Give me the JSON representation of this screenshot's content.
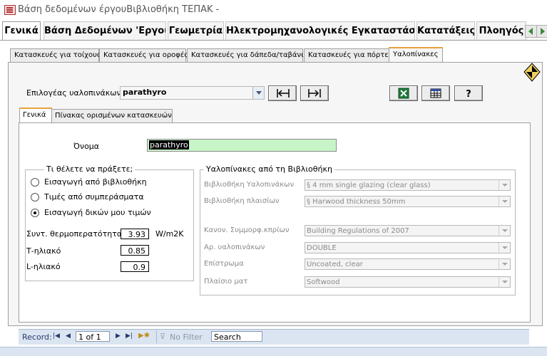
{
  "window": {
    "title": "Βάση δεδομένων έργουΒιβλιοθήκη ΤΕΠΑΚ -"
  },
  "main_tabs": [
    {
      "label": "Γενικά"
    },
    {
      "label": "Βάση Δεδομένων 'Εργου"
    },
    {
      "label": "Γεωμετρία"
    },
    {
      "label": "Ηλεκτρομηχανολογικές Εγκαταστάσεις"
    },
    {
      "label": "Κατατάξεις"
    },
    {
      "label": "Πλοηγός"
    }
  ],
  "sub_tabs": [
    {
      "label": "Κατασκευές για τοίχους"
    },
    {
      "label": "Κατασκευές για οροφές"
    },
    {
      "label": "Κατασκευές για δάπεδα/ταβάνια"
    },
    {
      "label": "Κατασκευές για πόρτες"
    },
    {
      "label": "Υαλοπίνακες"
    }
  ],
  "selector": {
    "label": "Επιλογέας υαλοπινάκων",
    "value": "parathyro"
  },
  "inner_tabs": [
    {
      "label": "Γενικά"
    },
    {
      "label": "Πίνακας ορισμένων κατασκευών"
    }
  ],
  "name_field": {
    "label": "Όνομα",
    "value": "parathyro"
  },
  "action_group": {
    "title": "Τι θέλετε να πράξετε;",
    "options": [
      {
        "label": "Εισαγωγή από βιβλιοθήκη",
        "selected": false
      },
      {
        "label": "Τιμές από συμπεράσματα",
        "selected": false
      },
      {
        "label": "Εισαγωγή δικών μου τιμών",
        "selected": true
      }
    ]
  },
  "values": {
    "u_label": "Συντ. θερμοπερατότητας",
    "u_value": "3.93",
    "u_unit": "W/m2K",
    "t_label": "Τ-ηλιακό",
    "t_value": "0.85",
    "l_label": "L-ηλιακό",
    "l_value": "0.9"
  },
  "library_group": {
    "title": "Υαλοπίνακες από τη Βιβλιοθήκη",
    "fields": [
      {
        "label": "Βιβλιοθήκη Υαλοπινάκων",
        "value": "§ 4 mm single glazing (clear glass)"
      },
      {
        "label": "Βιβλιοθήκη πλαισίων",
        "value": "§ Harwood thickness 50mm"
      },
      {
        "label": "Κανον. Συμμορφ.κπρίων",
        "value": "Building Regulations of 2007"
      },
      {
        "label": "Αρ. υαλοπινάκων",
        "value": "DOUBLE"
      },
      {
        "label": "Επίστρωμα",
        "value": "Uncoated, clear"
      },
      {
        "label": "Πλαίσιο ματ",
        "value": "Softwood"
      }
    ]
  },
  "status_bar": {
    "record_label": "Record:",
    "position": "1 of 1",
    "filter": "No Filter",
    "search": "Search"
  },
  "colors": {
    "name_field_bg": "#c8f5c8",
    "tab_accent": "#e8a23c",
    "status_bg": "#dbe5f2"
  }
}
